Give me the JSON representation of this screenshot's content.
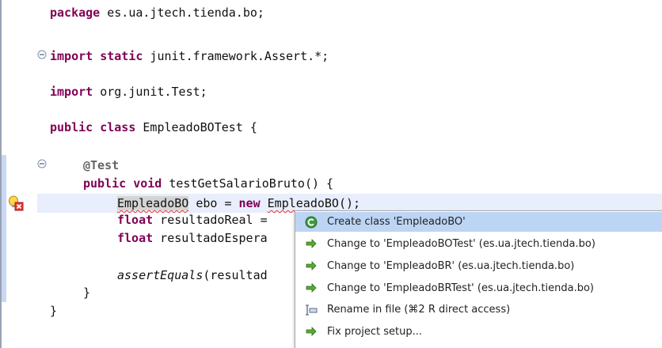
{
  "code": {
    "line1": {
      "kw": "package",
      "text": " es.ua.jtech.tienda.bo;"
    },
    "line2": {
      "kw": "import static",
      "text": " junit.framework.Assert.*;"
    },
    "line3": {
      "kw": "import",
      "text": " org.junit.Test;"
    },
    "line4": {
      "kw": "public class",
      "text": " EmpleadoBOTest {"
    },
    "line5": {
      "annotation": "@Test"
    },
    "line6": {
      "kw": "public void",
      "text": " testGetSalarioBruto() {"
    },
    "line7": {
      "type": "EmpleadoBO",
      "mid": " ebo = ",
      "kw": "new",
      "space": " ",
      "ctor": "EmpleadoBO",
      "tail": "();"
    },
    "line8": {
      "kw": "float",
      "text": " resultadoReal ="
    },
    "line9": {
      "kw": "float",
      "text": " resultadoEspera"
    },
    "line10": {
      "call": "assertEquals",
      "text": "(resultad"
    },
    "line11": {
      "text": "}"
    },
    "line12": {
      "text": "}"
    }
  },
  "quickfix": {
    "items": [
      {
        "label": "Create class 'EmpleadoBO'",
        "icon": "create-class-icon"
      },
      {
        "label": "Change to 'EmpleadoBOTest' (es.ua.jtech.tienda.bo)",
        "icon": "change-arrow-icon"
      },
      {
        "label": "Change to 'EmpleadoBR' (es.ua.jtech.tienda.bo)",
        "icon": "change-arrow-icon"
      },
      {
        "label": "Change to 'EmpleadoBRTest' (es.ua.jtech.tienda.bo)",
        "icon": "change-arrow-icon"
      },
      {
        "label": "Rename in file (⌘2 R direct access)",
        "icon": "rename-icon"
      },
      {
        "label": "Fix project setup...",
        "icon": "change-arrow-icon"
      }
    ]
  },
  "colors": {
    "keyword": "#7f0055",
    "annotation": "#646464",
    "error": "#e53935",
    "current_line": "#e8eefb",
    "selection": "#bdd5f4"
  }
}
